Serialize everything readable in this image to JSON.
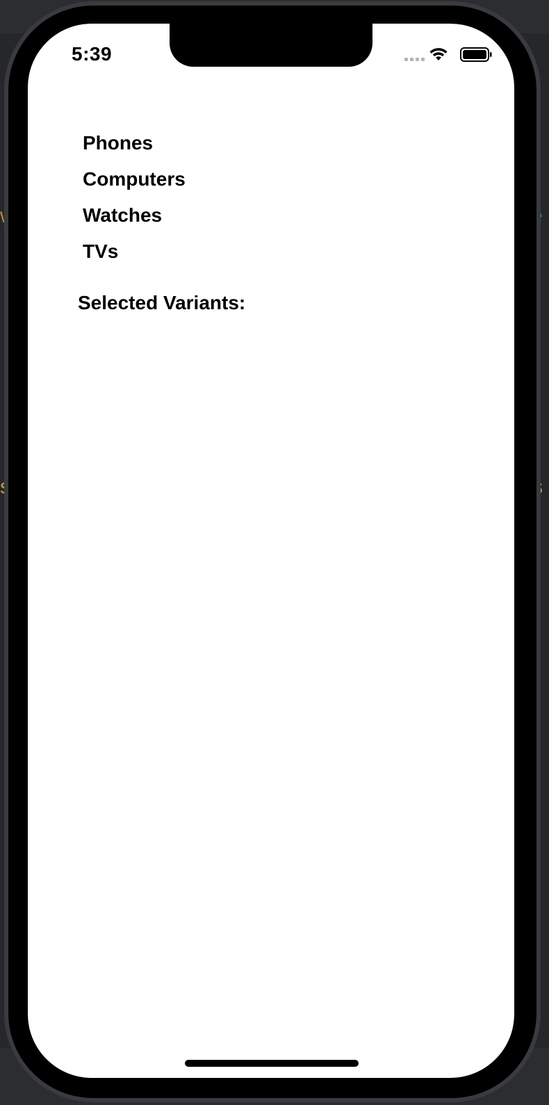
{
  "status_bar": {
    "time": "5:39",
    "icons": [
      "cellular-signal-icon",
      "wifi-icon",
      "battery-icon"
    ]
  },
  "menu": {
    "items": [
      {
        "label": "Phones"
      },
      {
        "label": "Computers"
      },
      {
        "label": "Watches"
      },
      {
        "label": "TVs"
      }
    ]
  },
  "selection": {
    "label": "Selected Variants:"
  },
  "colors": {
    "screen_background": "#ffffff",
    "text": "#000000",
    "device_bezel": "#000000",
    "background_accent": "#c89a4a"
  }
}
